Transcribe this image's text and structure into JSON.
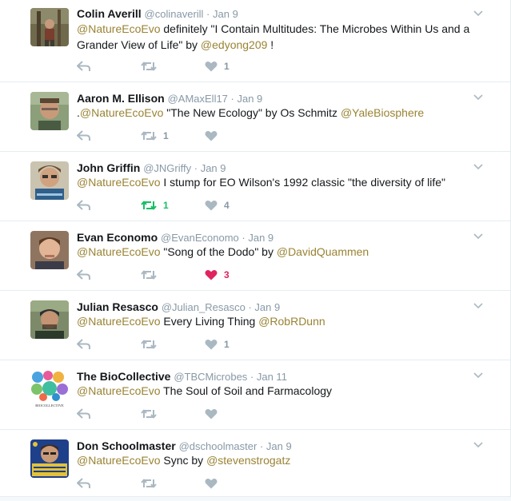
{
  "tweets": [
    {
      "name": "Colin Averill",
      "handle": "@colinaverill",
      "date": "Jan 9",
      "line1_mention": "@NatureEcoEvo",
      "line1_text": " definitely \"I Contain Multitudes: The Microbes Within Us and a",
      "line2_text": "Grander View of Life\" by ",
      "line2_mention": "@edyong209",
      "line2_after": " !",
      "retweets": "",
      "likes": "1",
      "liked": false,
      "retweeted": false
    },
    {
      "name": "Aaron M. Ellison",
      "handle": "@AMaxEll17",
      "date": "Jan 9",
      "prefix": ".",
      "line1_mention": "@NatureEcoEvo",
      "line1_text": " \"The New Ecology\" by Os Schmitz ",
      "line1_mention2": "@YaleBiosphere",
      "retweets": "1",
      "likes": "",
      "liked": false,
      "retweeted": false
    },
    {
      "name": "John Griffin",
      "handle": "@JNGriffy",
      "date": "Jan 9",
      "line1_mention": "@NatureEcoEvo",
      "line1_text": " I stump for EO Wilson's 1992 classic \"the diversity of life\"",
      "retweets": "1",
      "likes": "4",
      "liked": false,
      "retweeted": true
    },
    {
      "name": "Evan Economo",
      "handle": "@EvanEconomo",
      "date": "Jan 9",
      "line1_mention": "@NatureEcoEvo",
      "line1_text": " \"Song of the Dodo\" by ",
      "line1_mention2": "@DavidQuammen",
      "retweets": "",
      "likes": "3",
      "liked": true,
      "retweeted": false
    },
    {
      "name": "Julian Resasco",
      "handle": "@Julian_Resasco",
      "date": "Jan 9",
      "line1_mention": "@NatureEcoEvo",
      "line1_text": " Every Living Thing ",
      "line1_mention2": "@RobRDunn",
      "retweets": "",
      "likes": "1",
      "liked": false,
      "retweeted": false
    },
    {
      "name": "The BioCollective",
      "handle": "@TBCMicrobes",
      "date": "Jan 11",
      "line1_mention": "@NatureEcoEvo",
      "line1_text": " The Soul of Soil and Farmacology",
      "retweets": "",
      "likes": "",
      "liked": false,
      "retweeted": false,
      "avatar_text": "BIOCOLLECTIVE"
    },
    {
      "name": "Don Schoolmaster",
      "handle": "@dschoolmaster",
      "date": "Jan 9",
      "line1_mention": "@NatureEcoEvo",
      "line1_text": " Sync by ",
      "line1_mention2": "@stevenstrogatz",
      "retweets": "",
      "likes": "",
      "liked": false,
      "retweeted": false
    }
  ],
  "separator": " · ",
  "colors": {
    "mention": "#9a8334",
    "meta": "#8899a6",
    "icon": "#aab8c2",
    "retweeted": "#17bf63",
    "liked": "#e0245e"
  }
}
